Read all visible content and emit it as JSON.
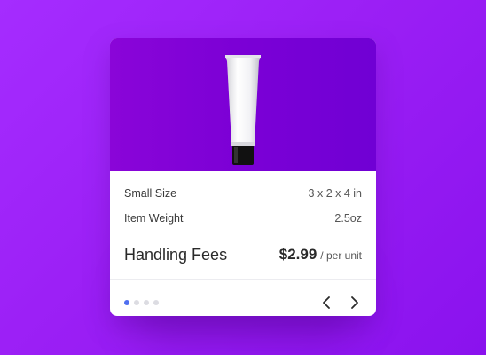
{
  "product": {
    "image_icon": "lotion-tube-icon"
  },
  "specs": {
    "size": {
      "label": "Small Size",
      "value": "3 x 2 x 4 in"
    },
    "weight": {
      "label": "Item Weight",
      "value": "2.5oz"
    },
    "fees": {
      "label": "Handling Fees",
      "price": "$2.99",
      "unit": "/ per unit"
    }
  },
  "pagination": {
    "total_dots": 4,
    "active_index": 0,
    "prev_icon": "chevron-left-icon",
    "next_icon": "chevron-right-icon"
  },
  "colors": {
    "background": "#9b1ff5",
    "hero": "#7b00d6",
    "active_dot": "#4f6ff0"
  }
}
